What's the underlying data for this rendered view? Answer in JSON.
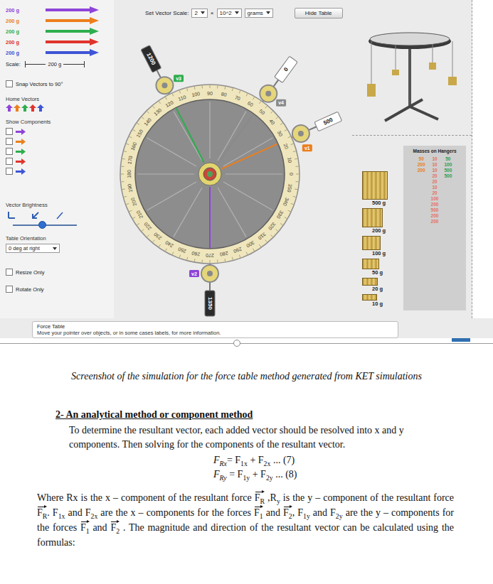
{
  "simulation": {
    "vectors": [
      {
        "label": "200 g",
        "color": "#8e44d8"
      },
      {
        "label": "200 g",
        "color": "#ec7f1c"
      },
      {
        "label": "200 g",
        "color": "#2eae4e"
      },
      {
        "label": "200 g",
        "color": "#e0342c"
      },
      {
        "label": "200 g",
        "color": "#3e55d6"
      }
    ],
    "scale": {
      "label": "Scale:",
      "value": "200 g"
    },
    "snap": {
      "label": "Snap Vectors to 90°",
      "checked": false
    },
    "home_vectors": {
      "label": "Home Vectors",
      "items": [
        {
          "color": "#8e44d8"
        },
        {
          "color": "#ec7f1c"
        },
        {
          "color": "#2eae4e"
        },
        {
          "color": "#e0342c"
        },
        {
          "color": "#3e55d6"
        }
      ]
    },
    "show_components": {
      "label": "Show Components",
      "items": [
        {
          "checked": false,
          "color": "#8e44d8"
        },
        {
          "checked": false,
          "color": "#ec7f1c"
        },
        {
          "checked": false,
          "color": "#2eae4e"
        },
        {
          "checked": false,
          "color": "#e0342c"
        },
        {
          "checked": false,
          "color": "#3e55d6"
        }
      ]
    },
    "brightness": {
      "label": "Vector Brightness",
      "level": 0.45
    },
    "orientation": {
      "label": "Table Orientation",
      "value": "0 deg at right"
    },
    "modes": [
      {
        "label": "Resize Only",
        "checked": false
      },
      {
        "label": "Rotate Only",
        "checked": false
      }
    ],
    "toolbar": {
      "label": "Set Vector Scale:",
      "scale": "2",
      "times": "×",
      "power": "10^2",
      "unit": "grams",
      "button": "Hide Table"
    },
    "table": {
      "ticks": [
        "0",
        "10",
        "20",
        "30",
        "40",
        "50",
        "60",
        "70",
        "80",
        "90",
        "100",
        "110",
        "120",
        "130",
        "140",
        "150",
        "160",
        "170",
        "180",
        "190",
        "200",
        "210",
        "220",
        "230",
        "240",
        "250",
        "260",
        "270",
        "280",
        "290",
        "300",
        "310",
        "320",
        "330",
        "340",
        "350"
      ],
      "pulleys": [
        {
          "vector": "v1",
          "mass": "500",
          "angle": 24,
          "color": "#ec7f1c",
          "dark": false
        },
        {
          "vector": "v2",
          "mass": "1350",
          "angle": 270,
          "color": "#8e44d8",
          "dark": true
        },
        {
          "vector": "v3",
          "mass": "1200",
          "angle": 117,
          "color": "#2eae4e",
          "dark": true
        },
        {
          "vector": "v4",
          "mass": "0",
          "angle": 54,
          "color": "#8a8a8a",
          "dark": false
        }
      ]
    },
    "masses": [
      "500 g",
      "200 g",
      "100 g",
      "50 g",
      "20 g",
      "10 g"
    ],
    "hangers": {
      "title": "Masses on Hangers",
      "columns": [
        {
          "color": "#e8801a",
          "values": [
            "50",
            "200",
            "200"
          ]
        },
        {
          "color": "#e5705f",
          "values": [
            "10",
            "10",
            "10",
            "20",
            "20",
            "10",
            "20",
            "100",
            "200",
            "500",
            "200",
            "200"
          ]
        },
        {
          "color": "#2e9e4f",
          "values": [
            "50",
            "100",
            "500",
            "500"
          ]
        }
      ]
    },
    "info": {
      "title": "Force Table",
      "text": "Move your pointer over objects, or in some cases labels, for more information."
    },
    "playback": {
      "level": 0.48
    }
  },
  "document": {
    "caption": "Screenshot of the simulation for the force table method generated from KET simulations",
    "heading": "2- An analytical method or component method",
    "intro": "To determine the resultant vector, each added vector should be resolved into x and y components. Then solving for the components of the resultant vector.",
    "equations": [
      [
        {
          "text": "F",
          "sub": "Rx",
          "style": "italic"
        },
        {
          "text": "= F",
          "sub": "1x",
          "style": "plain"
        },
        {
          "text": " + F",
          "sub": "2x",
          "style": "plain"
        },
        {
          "text": " ... (7)",
          "sub": "",
          "style": "plain"
        }
      ],
      [
        {
          "text": "F",
          "sub": "Ry",
          "style": "italic"
        },
        {
          "text": " = F",
          "sub": "1y",
          "style": "plain"
        },
        {
          "text": " + F",
          "sub": "2y",
          "style": "plain"
        },
        {
          "text": " ... (8)",
          "sub": "",
          "style": "plain"
        }
      ]
    ],
    "explanation": [
      {
        "text": "Where Rx is the x – component of the resultant force ",
        "sub": "",
        "style": "plain"
      },
      {
        "text": "F",
        "sub": "R",
        "style": "vector"
      },
      {
        "text": " ,R",
        "sub": "y",
        "style": "plain"
      },
      {
        "text": " is the y – component of the resultant force ",
        "sub": "",
        "style": "plain"
      },
      {
        "text": "F",
        "sub": "R",
        "style": "vector"
      },
      {
        "text": ". F",
        "sub": "1x",
        "style": "plain"
      },
      {
        "text": " and F",
        "sub": "2x",
        "style": "plain"
      },
      {
        "text": " are the x – components for the forces ",
        "sub": "",
        "style": "plain"
      },
      {
        "text": "F",
        "sub": "1",
        "style": "vector"
      },
      {
        "text": " and ",
        "sub": "",
        "style": "plain"
      },
      {
        "text": "F",
        "sub": "2",
        "style": "vector"
      },
      {
        "text": ", F",
        "sub": "1y",
        "style": "plain"
      },
      {
        "text": " and F",
        "sub": "2y",
        "style": "plain"
      },
      {
        "text": " are the y – components for the forces ",
        "sub": "",
        "style": "plain"
      },
      {
        "text": "F",
        "sub": "1",
        "style": "vector"
      },
      {
        "text": " and ",
        "sub": "",
        "style": "plain"
      },
      {
        "text": "F",
        "sub": "2",
        "style": "vector"
      },
      {
        "text": " . The magnitude and direction of the resultant vector can be calculated using the formulas:",
        "sub": "",
        "style": "plain"
      }
    ]
  }
}
